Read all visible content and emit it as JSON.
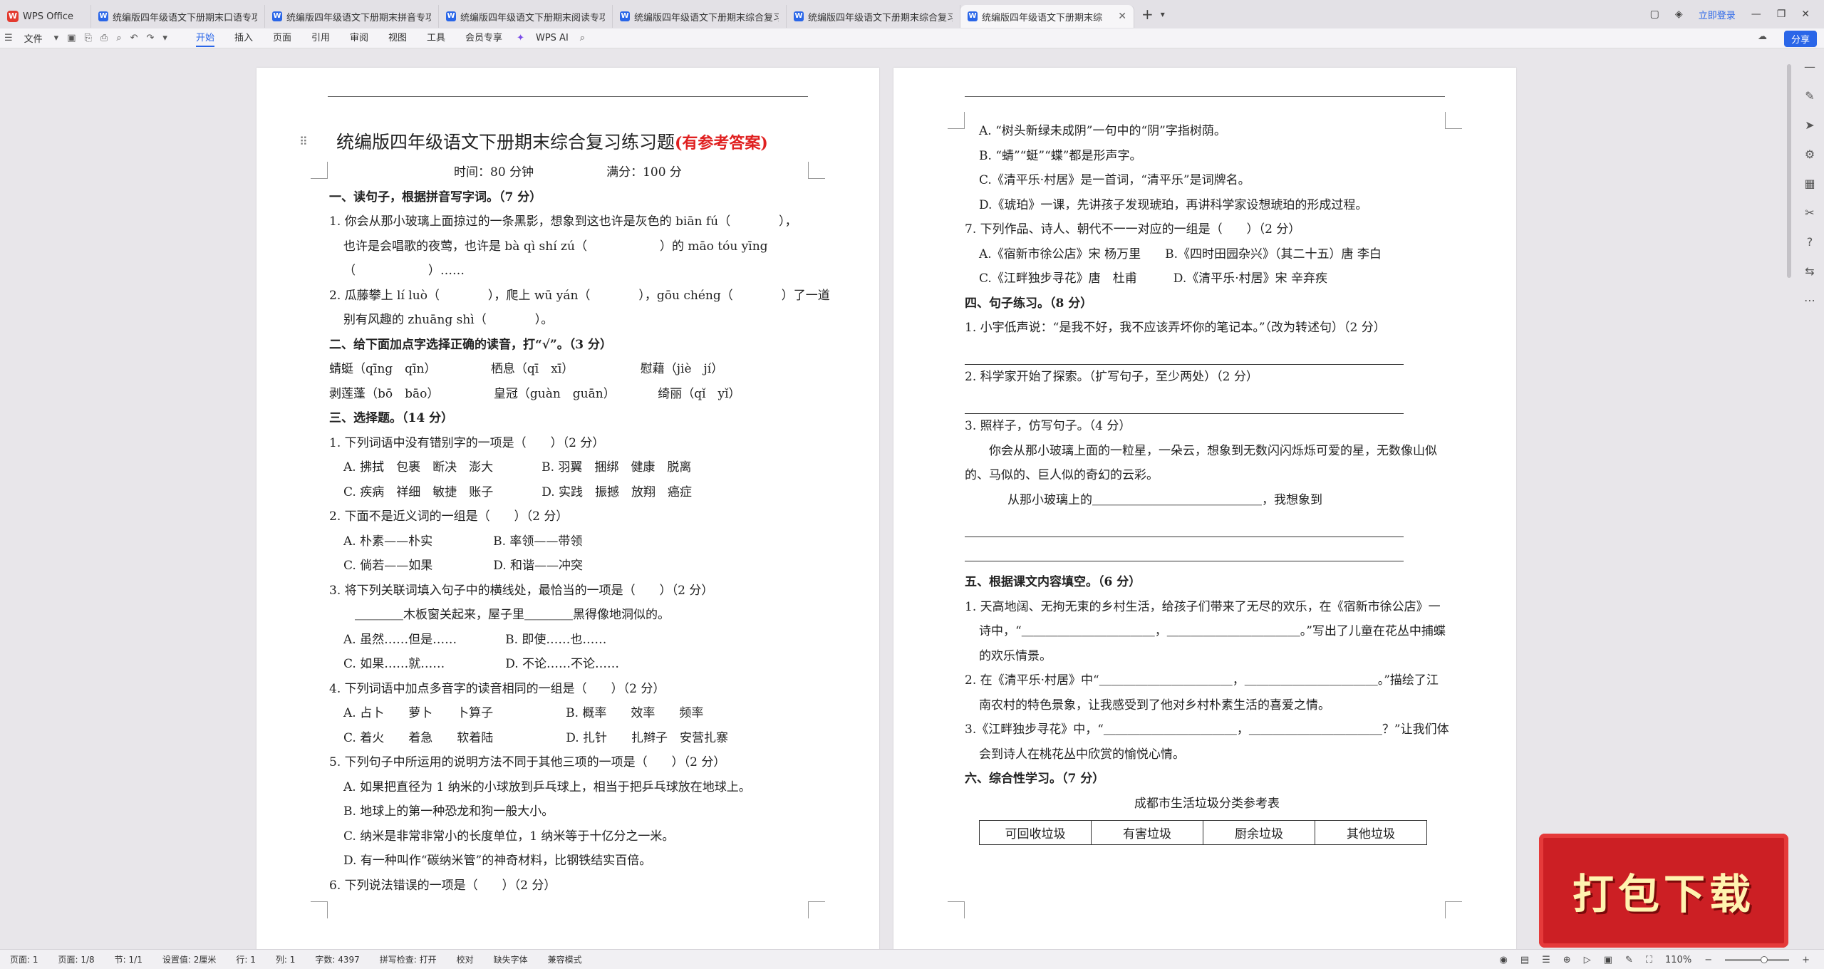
{
  "tabs": [
    {
      "label": "WPS Office",
      "kind": "home"
    },
    {
      "label": "统编版四年级语文下册期末口语专项",
      "kind": "doc"
    },
    {
      "label": "统编版四年级语文下册期末拼音专项",
      "kind": "doc"
    },
    {
      "label": "统编版四年级语文下册期末阅读专项",
      "kind": "doc"
    },
    {
      "label": "统编版四年级语文下册期末综合复习",
      "kind": "doc"
    },
    {
      "label": "统编版四年级语文下册期末综合复习",
      "kind": "doc"
    },
    {
      "label": "统编版四年级语文下册期末综",
      "kind": "doc-active"
    }
  ],
  "titlebar": {
    "login": "立即登录"
  },
  "ribbon": {
    "file": "文件",
    "menu": [
      "开始",
      "插入",
      "页面",
      "引用",
      "审阅",
      "视图",
      "工具",
      "会员专享"
    ],
    "active_menu": "开始",
    "ai": "WPS AI",
    "share": "分享"
  },
  "page1": {
    "title": "统编版四年级语文下册期末综合复习练习题",
    "title_note": "(有参考答案)",
    "meta": "时间：80 分钟　　　　　　满分：100 分",
    "lines": [
      {
        "t": "一、读句子，根据拼音写字词。（7 分）",
        "cls": "bold"
      },
      {
        "t": "1. 你会从那小玻璃上面掠过的一条黑影，想象到这也许是灰色的 biān fú（　　　　），",
        "cls": ""
      },
      {
        "t": "也许是会唱歌的夜莺，也许是 bà qì shí zú（　　　　　　）的 māo tóu yīng",
        "cls": "ind"
      },
      {
        "t": "（　　　　　　）……",
        "cls": "ind"
      },
      {
        "t": "2. 瓜藤攀上 lí luò（　　　　），爬上 wū yán（　　　　），gōu chéng（　　　　）了一道",
        "cls": ""
      },
      {
        "t": "别有风趣的 zhuāng shì（　　　　）。",
        "cls": "ind"
      },
      {
        "t": "二、给下面加点字选择正确的读音，打“√”。（3 分）",
        "cls": "bold"
      },
      {
        "t": "蜻蜓（qīng　qīn）　　　　　栖息（qī　xī）　　　　　　慰藉（jiè　jí）",
        "cls": ""
      },
      {
        "t": "剥莲蓬（bō　bāo）　　　　　皇冠（guàn　guān）　　　　绮丽（qǐ　yǐ）",
        "cls": ""
      },
      {
        "t": "三、选择题。（14 分）",
        "cls": "bold"
      },
      {
        "t": "1. 下列词语中没有错别字的一项是（　　）（2 分）",
        "cls": ""
      },
      {
        "t": "A. 拂拭　包裹　断决　澎大　　　　B. 羽翼　捆绑　健康　脱离",
        "cls": "ind"
      },
      {
        "t": "C. 疾病　祥细　敏捷　账子　　　　D. 实践　振撼　放翔　癌症",
        "cls": "ind"
      },
      {
        "t": "2. 下面不是近义词的一组是（　　）（2 分）",
        "cls": ""
      },
      {
        "t": "A. 朴素——朴实　　　　　B. 率领——带领",
        "cls": "ind"
      },
      {
        "t": "C. 倘若——如果　　　　　D. 和谐——冲突",
        "cls": "ind"
      },
      {
        "t": "3. 将下列关联词填入句子中的横线处，最恰当的一项是（　　）（2 分）",
        "cls": ""
      },
      {
        "t": "＿＿＿＿木板窗关起来，屋子里＿＿＿＿黑得像地洞似的。",
        "cls": "ind2"
      },
      {
        "t": "A. 虽然……但是……　　　　B. 即使……也……",
        "cls": "ind"
      },
      {
        "t": "C. 如果……就……　　　　　D. 不论……不论……",
        "cls": "ind"
      },
      {
        "t": "4. 下列词语中加点多音字的读音相同的一组是（　　）（2 分）",
        "cls": ""
      },
      {
        "t": "A. 占卜　　萝卜　　卜算子　　　　　　B. 概率　　效率　　频率",
        "cls": "ind"
      },
      {
        "t": "C. 着火　　着急　　软着陆　　　　　　D. 扎针　　扎辫子　安营扎寨",
        "cls": "ind"
      },
      {
        "t": "5. 下列句子中所运用的说明方法不同于其他三项的一项是（　　）（2 分）",
        "cls": ""
      },
      {
        "t": "A. 如果把直径为 1 纳米的小球放到乒乓球上，相当于把乒乓球放在地球上。",
        "cls": "ind"
      },
      {
        "t": "B. 地球上的第一种恐龙和狗一般大小。",
        "cls": "ind"
      },
      {
        "t": "C. 纳米是非常非常小的长度单位，1 纳米等于十亿分之一米。",
        "cls": "ind"
      },
      {
        "t": "D. 有一种叫作“碳纳米管”的神奇材料，比钢铁结实百倍。",
        "cls": "ind"
      },
      {
        "t": "6. 下列说法错误的一项是（　　）（2 分）",
        "cls": ""
      }
    ]
  },
  "page2": {
    "lines_a": [
      {
        "t": "A. “树头新绿未成阴”一句中的“阴”字指树荫。",
        "cls": "ind"
      },
      {
        "t": "B. “蜻”“蜓”“蝶”都是形声字。",
        "cls": "ind"
      },
      {
        "t": "C.《清平乐·村居》是一首词，“清平乐”是词牌名。",
        "cls": "ind"
      },
      {
        "t": "D.《琥珀》一课，先讲孩子发现琥珀，再讲科学家设想琥珀的形成过程。",
        "cls": "ind"
      },
      {
        "t": "7. 下列作品、诗人、朝代不一一对应的一组是（　　）（2 分）",
        "cls": ""
      },
      {
        "t": "A.《宿新市徐公店》宋 杨万里　　B.《四时田园杂兴》（其二十五）唐 李白",
        "cls": "ind"
      },
      {
        "t": "C.《江畔独步寻花》唐　杜甫　　　D.《清平乐·村居》宋 辛弃疾",
        "cls": "ind"
      },
      {
        "t": "四、句子练习。（8 分）",
        "cls": "bold"
      },
      {
        "t": "1. 小宇低声说：“是我不好，我不应该弄坏你的笔记本。”（改为转述句）（2 分）",
        "cls": ""
      }
    ],
    "q2": "2. 科学家开始了探索。（扩写句子，至少两处）（2 分）",
    "q3": "3. 照样子，仿写句子。（4 分）",
    "q3_example": "你会从那小玻璃上面的一粒星，一朵云，想象到无数闪闪烁烁可爱的星，无数像山似的、马似的、巨人似的奇幻的云彩。",
    "q3_prompt": "从那小玻璃上的＿＿＿＿＿＿＿＿＿＿＿＿＿＿，我想象到",
    "sec5": "五、根据课文内容填空。（6 分）",
    "sec5_q1": "1. 天高地阔、无拘无束的乡村生活，给孩子们带来了无尽的欢乐，在《宿新市徐公店》一诗中，“＿＿＿＿＿＿＿＿＿＿＿，＿＿＿＿＿＿＿＿＿＿＿。”写出了儿童在花丛中捕蝶的欢乐情景。",
    "sec5_q2": "2. 在《清平乐·村居》中“＿＿＿＿＿＿＿＿＿＿＿，＿＿＿＿＿＿＿＿＿＿＿。”描绘了江南农村的特色景象，让我感受到了他对乡村朴素生活的喜爱之情。",
    "sec5_q3": "3.《江畔独步寻花》中，“＿＿＿＿＿＿＿＿＿＿＿，＿＿＿＿＿＿＿＿＿＿＿？”让我们体会到诗人在桃花丛中欣赏的愉悦心情。",
    "sec6": "六、综合性学习。（7 分）",
    "table_caption": "成都市生活垃圾分类参考表",
    "table_headers": [
      "可回收垃圾",
      "有害垃圾",
      "厨余垃圾",
      "其他垃圾"
    ]
  },
  "banner": "打包下载",
  "status": {
    "items": [
      "页面: 1",
      "页面: 1/8",
      "节: 1/1",
      "设置值: 2厘米",
      "行: 1",
      "列: 1",
      "字数: 4397",
      "拼写检查: 打开",
      "校对",
      "缺失字体",
      "兼容模式"
    ],
    "zoom": "110%"
  }
}
